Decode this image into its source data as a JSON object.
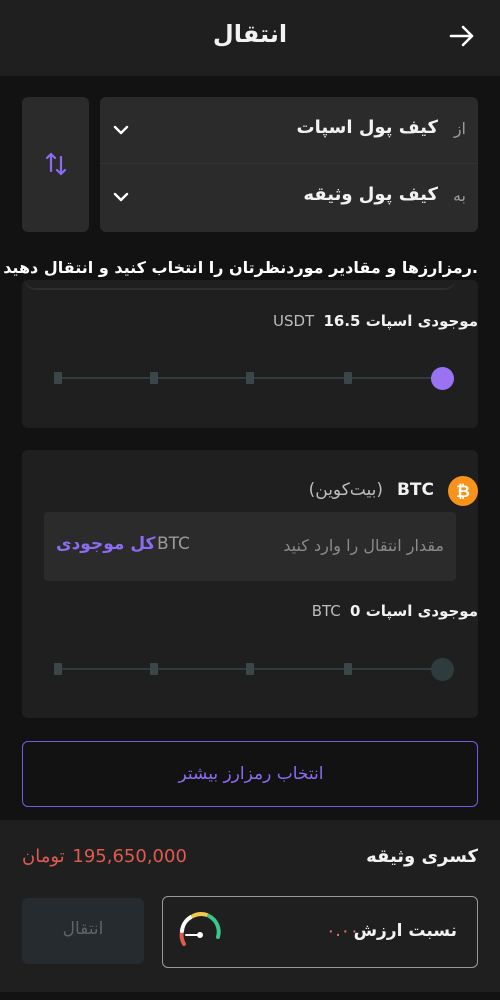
{
  "header": {
    "title": "انتقال",
    "back_icon": "arrow-right-icon"
  },
  "wallets": {
    "from": {
      "prefix": "از",
      "name": "کیف پول اسپات"
    },
    "to": {
      "prefix": "به",
      "name": "کیف پول وثیقه"
    },
    "swap_icon": "swap-vertical-icon"
  },
  "instruction": "رمزارزها و مقادیر موردنظرتان را انتخاب کنید و انتقال دهید.",
  "usdt": {
    "balance_label": "موجودی اسپات",
    "balance_amount": "16.5",
    "balance_currency": "USDT",
    "slider_fraction": 1.0
  },
  "btc": {
    "symbol": "BTC",
    "name": "(بیت‌کوین)",
    "input_placeholder": "مقدار انتقال را وارد کنید",
    "input_currency": "BTC",
    "all_balance": "کل موجودی",
    "balance_label": "موجودی اسپات",
    "balance_amount": "0",
    "balance_currency": "BTC",
    "slider_fraction": 1.0
  },
  "more_button": "انتخاب رمزارز بیشتر",
  "footer": {
    "collateral_label": "کسری وثیقه",
    "collateral_amount": "195,650,000",
    "collateral_unit": "تومان",
    "transfer_button": "انتقال",
    "ratio_label": "نسبت ارزش",
    "ratio_value": "۰.۰۰"
  },
  "colors": {
    "accent": "#8b6cf0",
    "danger": "#e05a50",
    "btc_orange": "#f7931a"
  }
}
